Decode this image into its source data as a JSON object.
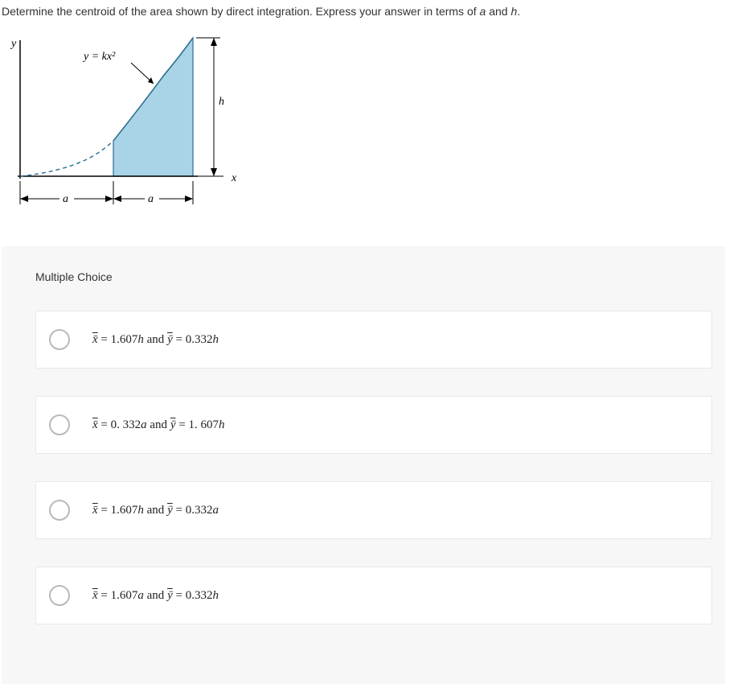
{
  "question": {
    "prompt_prefix": "Determine the centroid of the area shown by direct integration. Express your answer in terms of ",
    "var_a": "a",
    "and": " and ",
    "var_h": "h",
    "period": "."
  },
  "figure": {
    "y_axis": "y",
    "x_axis": "x",
    "curve_label": "y = kx²",
    "h_label": "h",
    "a_label_left": "a",
    "a_label_right": "a"
  },
  "mc_label": "Multiple Choice",
  "options": [
    {
      "x_coef": "1.607",
      "x_unit": "h",
      "y_coef": "0.332",
      "y_unit": "h"
    },
    {
      "x_coef": "0. 332",
      "x_unit": "a",
      "y_coef": "1. 607",
      "y_unit": "h"
    },
    {
      "x_coef": "1.607",
      "x_unit": "h",
      "y_coef": "0.332",
      "y_unit": "a"
    },
    {
      "x_coef": "1.607",
      "x_unit": "a",
      "y_coef": "0.332",
      "y_unit": "h"
    }
  ],
  "sym": {
    "xbar": "x̄",
    "ybar": "ȳ",
    "eq": " = ",
    "and": " and "
  }
}
